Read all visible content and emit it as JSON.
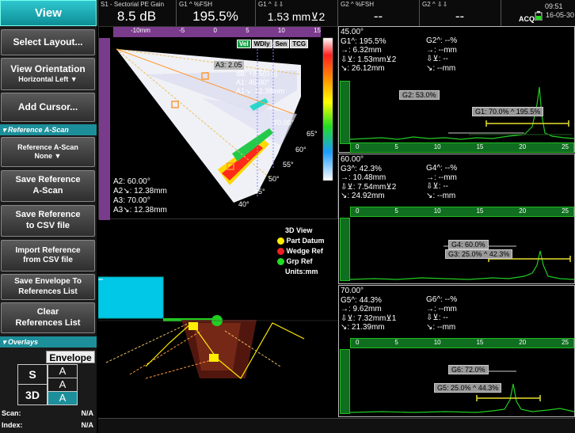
{
  "view_tab": "View",
  "header": {
    "cells": [
      {
        "title": "S1 - Sectorial PE Gain",
        "value": "8.5 dB"
      },
      {
        "title": "G1 ^ %FSH",
        "value": "195.5%"
      },
      {
        "title": "G1 ^ ⇩⇩",
        "value": "1.53 mm⊻2"
      },
      {
        "title": "G2 ^ %FSH",
        "value": "--"
      },
      {
        "title": "G2 ^ ⇩⇩",
        "value": "--"
      }
    ],
    "time": "09:51",
    "date": "16-05-30",
    "acq": "ACQ"
  },
  "left_panel": {
    "select_layout": "Select Layout...",
    "view_orientation": "View Orientation",
    "view_orientation_value": "Horizontal Left",
    "add_cursor": "Add Cursor...",
    "section_reference": "Reference A-Scan",
    "reference_ascan_label": "Reference A-Scan",
    "reference_ascan_value": "None",
    "save_reference_ascan": [
      "Save Reference",
      "A-Scan"
    ],
    "save_reference_csv": [
      "Save Reference",
      "to CSV file"
    ],
    "import_reference_csv": [
      "Import Reference",
      "from CSV file"
    ],
    "save_envelope": [
      "Save Envelope To",
      "References List"
    ],
    "clear_references": [
      "Clear",
      "References List"
    ],
    "section_overlays": "Overlays",
    "envelope_label": "Envelope",
    "envelope_rows": [
      {
        "mode": "S",
        "value": "A"
      },
      {
        "mode": "",
        "value": "A"
      },
      {
        "mode": "3D",
        "value": "A"
      }
    ],
    "scan_label": "Scan:",
    "scan_value": "N/A",
    "index_label": "Index:",
    "index_value": "N/A"
  },
  "sector": {
    "top_ruler_labels": [
      "-10mm",
      "-5",
      "0",
      "5",
      "10",
      "15"
    ],
    "buttons": [
      "Vel",
      "WDly",
      "Sen",
      "TCG"
    ],
    "overlay_top": [
      "A3: 2.05",
      "dB: +8.5(0.0)",
      "A1: 45.00°",
      "A1↘: 12.38mm"
    ],
    "overlay_bottom": [
      "A2: 60.00°",
      "A2↘: 12.38mm",
      "A3: 70.00°",
      "A3↘: 12.38mm"
    ],
    "angle_labels": [
      "70.00°",
      "65°",
      "60°",
      "55°",
      "50°",
      "45°",
      "40°"
    ]
  },
  "view3d": {
    "title": "3D View",
    "legend": [
      {
        "label": "Part Datum",
        "color": "#ffee00"
      },
      {
        "label": "Wedge Ref",
        "color": "#ee2222"
      },
      {
        "label": "Grp Ref",
        "color": "#22dd22"
      }
    ],
    "units": "Units:mm"
  },
  "ascans": [
    {
      "readings": [
        "45.00°",
        "G1^: 195.5%",
        "→: 6.32mm",
        "⇩⊻: 1.53mm⊻2",
        "↘: 26.12mm"
      ],
      "readings_right": [
        "G2^: --%",
        "→: --mm",
        "⇩⊻: --",
        "↘: --mm"
      ],
      "ruler_labels": [
        "0",
        "5",
        "10",
        "15",
        "20",
        "25"
      ],
      "gate_labels": [
        "G2: 53.0%",
        "G1: 70.0% ^ 195.5%"
      ],
      "peak_x": 0.86
    },
    {
      "readings": [
        "60.00°",
        "G3^: 42.3%",
        "→: 10.48mm",
        "⇩⊻: 7.54mm⊻2",
        "↘: 24.92mm"
      ],
      "readings_right": [
        "G4^: --%",
        "→: --mm",
        "⇩⊻: --",
        "↘: --mm"
      ],
      "ruler_labels": [
        "0",
        "5",
        "10",
        "15",
        "20",
        "25"
      ],
      "gate_labels": [
        "G4: 60.0%",
        "G3: 25.0% ^ 42.3%"
      ],
      "peak_x": 0.75
    },
    {
      "readings": [
        "70.00°",
        "G5^: 44.3%",
        "→: 9.62mm",
        "⇩⊻: 7.32mm⊻1",
        "↘: 21.39mm"
      ],
      "readings_right": [
        "G6^: --%",
        "→: --mm",
        "⇩⊻: --",
        "↘: --mm"
      ],
      "ruler_labels": [
        "0",
        "5",
        "10",
        "15",
        "20",
        "25"
      ],
      "gate_labels": [
        "G6: 72.0%",
        "G5: 25.0% ^ 44.3%"
      ],
      "peak_x": 0.7
    }
  ]
}
